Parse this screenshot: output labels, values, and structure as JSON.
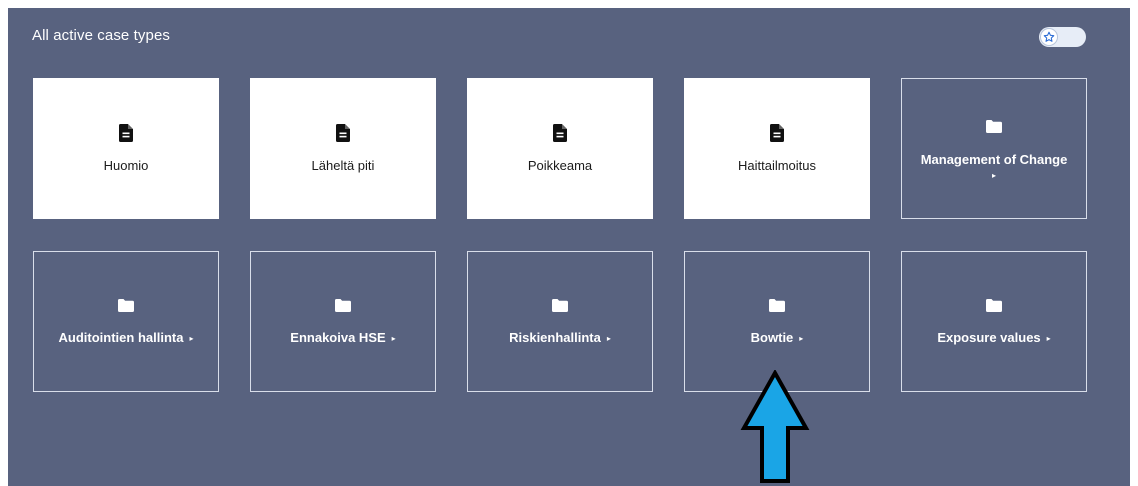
{
  "header": {
    "title": "All active case types",
    "favorites_toggle": {
      "icon": "star-icon",
      "state": "off"
    }
  },
  "colors": {
    "panel_bg": "#58627f",
    "tile_white": "#ffffff",
    "folder_border": "#d9deea",
    "arrow_fill": "#1aa5e6"
  },
  "tiles": [
    {
      "label": "Huomio",
      "icon": "document-icon",
      "kind": "case"
    },
    {
      "label": "Läheltä piti",
      "icon": "document-icon",
      "kind": "case"
    },
    {
      "label": "Poikkeama",
      "icon": "document-icon",
      "kind": "case"
    },
    {
      "label": "Haittailmoitus",
      "icon": "document-icon",
      "kind": "case"
    },
    {
      "label": "Management of Change",
      "icon": "folder-icon",
      "kind": "folder",
      "caret": "▸"
    },
    {
      "label": "Auditointien hallinta",
      "icon": "folder-icon",
      "kind": "folder",
      "caret": "▸"
    },
    {
      "label": "Ennakoiva HSE",
      "icon": "folder-icon",
      "kind": "folder",
      "caret": "▸"
    },
    {
      "label": "Riskienhallinta",
      "icon": "folder-icon",
      "kind": "folder",
      "caret": "▸"
    },
    {
      "label": "Bowtie",
      "icon": "folder-icon",
      "kind": "folder",
      "caret": "▸"
    },
    {
      "label": "Exposure values",
      "icon": "folder-icon",
      "kind": "folder",
      "caret": "▸"
    }
  ],
  "annotation": {
    "icon": "up-arrow-icon",
    "points_to": "Bowtie"
  }
}
